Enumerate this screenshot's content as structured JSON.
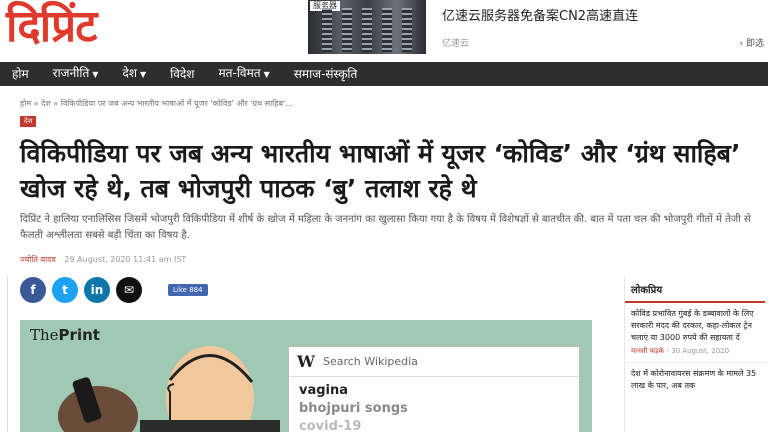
{
  "site": {
    "logo": "दिप्रिंट"
  },
  "ad": {
    "tag": "服务器",
    "title": "亿速云服务器免备案CN2高速直连",
    "source": "亿速云",
    "cta": "› 即选"
  },
  "nav": [
    {
      "label": "होम",
      "dropdown": false
    },
    {
      "label": "राजनीति",
      "dropdown": true
    },
    {
      "label": "देश",
      "dropdown": true
    },
    {
      "label": "विदेश",
      "dropdown": false
    },
    {
      "label": "मत-विमत",
      "dropdown": true
    },
    {
      "label": "समाज-संस्कृति",
      "dropdown": false
    }
  ],
  "breadcrumb": "होम  »  देश  »  विकिपीडिया पर जब अन्य भारतीय भाषाओं में यूजर 'कोविड' और 'ग्रंथ साहिब'...",
  "category": "देश",
  "headline": "विकिपीडिया पर जब अन्य भारतीय भाषाओं में यूजर ‘कोविड’ और ‘ग्रंथ साहिब’ खोज रहे थे, तब भोजपुरी पाठक ‘बु’ तलाश रहे थे",
  "summary": "दिप्रिंट ने हालिया एनालिसिस जिसमें भोजपुरी विकिपीडिया में शीर्ष के खोज में महिला के जननांग का खुलासा किया गया है के विषय में विशेषज्ञों से बातचीत की. बात में पता चल की भोजपुरी गीतों में तेजी से फैलती अश्लीलता सबसे बड़ी चिंता का विषय है.",
  "byline": {
    "author": "ज्योति यादव",
    "date": "29 August, 2020 11:41 am IST"
  },
  "share": {
    "facebook": "f",
    "twitter": "t",
    "linkedin": "in",
    "mail": "✉",
    "like": "Like 884"
  },
  "colors": {
    "accent": "#c0392b",
    "logo": "#e03a2c",
    "nav_bg": "#2e2e2e",
    "facebook": "#3b5998",
    "twitter": "#1da1f2",
    "linkedin": "#0e76a8"
  },
  "hero": {
    "brand_prefix": "The",
    "brand_bold": "Print",
    "wiki_logo": "W",
    "search_placeholder": "Search Wikipedia",
    "suggestions": [
      "vagina",
      "bhojpuri songs",
      "covid-19"
    ]
  },
  "sidebar": {
    "title": "लोकप्रिय",
    "items": [
      {
        "text": "कोविड प्रभावित गुंबई के डब्बावालों के लिए सरकारी मदद की दरकार, कहा-लोकल ट्रेन चलाएं या 3000 रुपये की सहायता दें",
        "author": "मानसी फड़के",
        "date": "30 August, 2020"
      },
      {
        "text": "देश में कोरोनावायरस संक्रमण के मामले 35 लाख के पार, अब तक",
        "author": "",
        "date": ""
      }
    ]
  }
}
